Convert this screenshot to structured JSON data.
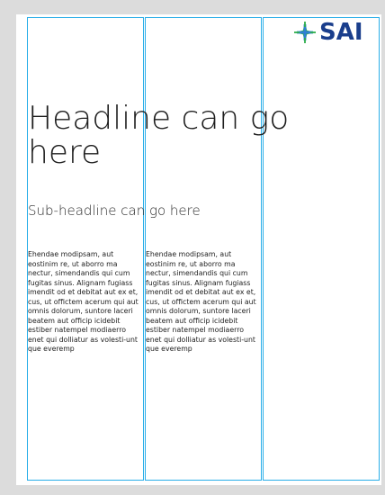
{
  "brand": {
    "logo_text": "SAI",
    "logo_icon": "star-cross-icon",
    "colors": {
      "navy": "#1a3e8c",
      "green": "#2fae4b",
      "blue": "#2f7fd3"
    }
  },
  "guide_color": "#29aee8",
  "headline": "Headline can go here",
  "subheadline": "Sub-headline can go here",
  "columns": [
    {
      "text": "Ehendae modipsam, aut eostinim re, ut aborro ma nectur, simendandis qui cum fugitas sinus. Alignam fugiass imendit od et debitat aut ex et, cus, ut offictem acerum qui aut omnis dolorum, suntore laceri beatem aut officip icidebit estiber natempel modiaerro enet qui dolliatur as volesti-unt que everemp"
    },
    {
      "text": "Ehendae modipsam, aut eostinim re, ut aborro ma nectur, simendandis qui cum fugitas sinus. Alignam fugiass imendit od et debitat aut ex et, cus, ut offictem acerum qui aut omnis dolorum, suntore laceri beatem aut officip icidebit estiber natempel modiaerro enet qui dolliatur as volesti-unt que everemp"
    }
  ]
}
